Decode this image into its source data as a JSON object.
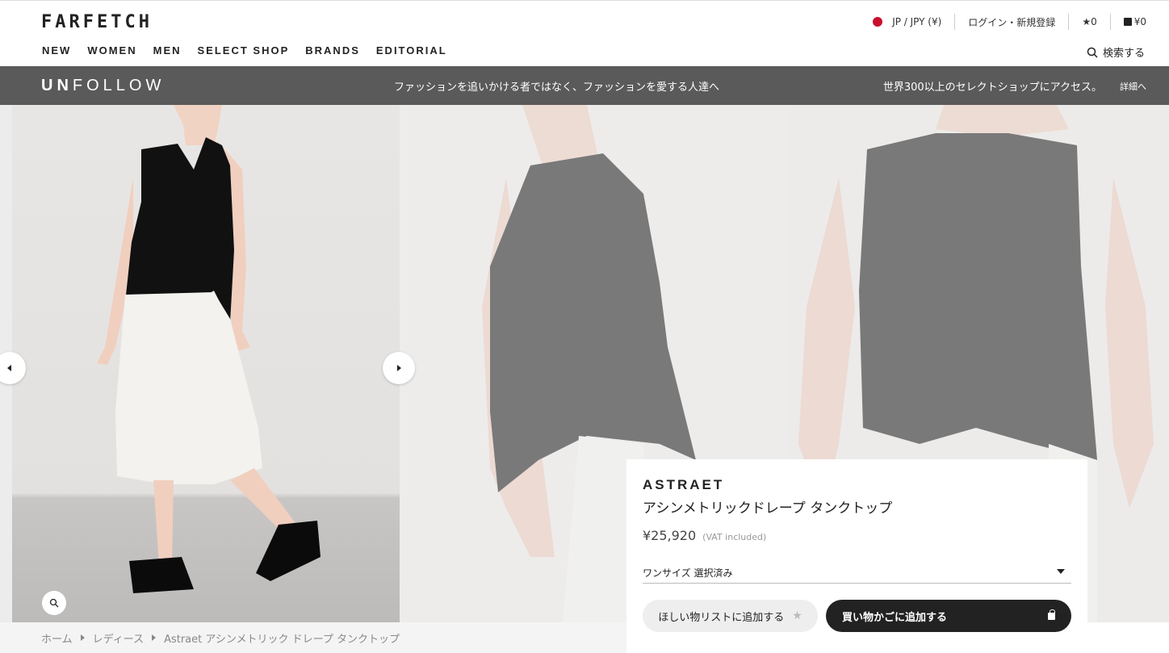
{
  "header": {
    "logo": "FARFETCH",
    "nav": [
      "NEW",
      "WOMEN",
      "MEN",
      "SELECT SHOP",
      "BRANDS",
      "EDITORIAL"
    ],
    "region": "JP / JPY (¥)",
    "login": "ログイン・新規登録",
    "wishlist_count": "★0",
    "bag_total": "¥0",
    "search_label": "検索する"
  },
  "banner": {
    "logo_bold": "UN",
    "logo_rest": "FOLLOW",
    "tagline": "ファッションを追いかける者ではなく、ファッションを愛する人達へ",
    "right_text": "世界300以上のセレクトショップにアクセス。",
    "more_link": "詳細へ"
  },
  "product": {
    "brand": "ASTRAET",
    "name": "アシンメトリックドレープ タンクトップ",
    "price": "¥25,920",
    "vat": "(VAT included)",
    "size_selected": "ワンサイズ 選択済み",
    "wishlist_button": "ほしい物リストに追加する",
    "cart_button": "買い物かごに追加する"
  },
  "breadcrumb": [
    "ホーム",
    "レディース",
    "Astraet アシンメトリック ドレープ タンクトップ"
  ],
  "colors": {
    "banner_bg": "#5a5a5a",
    "button_dark": "#222222",
    "flag_red": "#c8102e"
  }
}
